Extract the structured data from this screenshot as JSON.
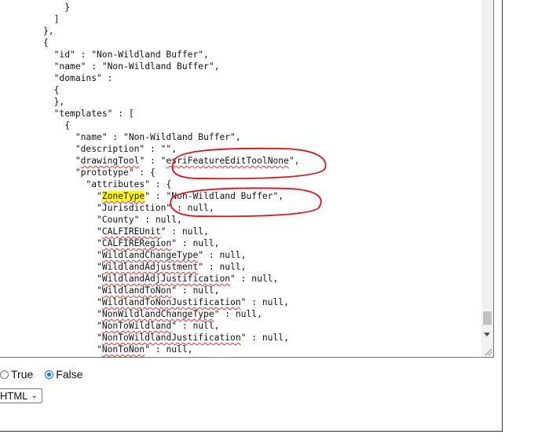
{
  "json_editor": {
    "lines": [
      {
        "indent": "      ",
        "segments": [
          {
            "text": "}"
          }
        ]
      },
      {
        "indent": "    ",
        "segments": [
          {
            "text": "}"
          }
        ]
      },
      {
        "indent": "  ",
        "segments": [
          {
            "text": "]"
          }
        ]
      },
      {
        "indent": "",
        "segments": [
          {
            "text": "},"
          }
        ]
      },
      {
        "indent": "",
        "segments": [
          {
            "text": "{"
          }
        ]
      },
      {
        "indent": "  ",
        "segments": [
          {
            "text": "\"id\" : \"Non-Wildland Buffer\","
          }
        ]
      },
      {
        "indent": "  ",
        "segments": [
          {
            "text": "\"name\" : \"Non-Wildland Buffer\","
          }
        ]
      },
      {
        "indent": "  ",
        "segments": [
          {
            "text": "\"domains\" :"
          }
        ]
      },
      {
        "indent": "  ",
        "segments": [
          {
            "text": "{"
          }
        ]
      },
      {
        "indent": "  ",
        "segments": [
          {
            "text": "},"
          }
        ]
      },
      {
        "indent": "  ",
        "segments": [
          {
            "text": "\"templates\" : ["
          }
        ]
      },
      {
        "indent": "    ",
        "segments": [
          {
            "text": "{"
          }
        ]
      },
      {
        "indent": "      ",
        "segments": [
          {
            "text": "\"name\" : \"Non-Wildland Buffer\","
          }
        ]
      },
      {
        "indent": "      ",
        "segments": [
          {
            "text": "\"description\" : \"\","
          }
        ]
      },
      {
        "indent": "      ",
        "segments": [
          {
            "text": "\""
          },
          {
            "text": "drawingTool",
            "squiggle": true
          },
          {
            "text": "\" : \""
          },
          {
            "text": "esriFeatureEditToolNone",
            "squiggle": true
          },
          {
            "text": "\","
          }
        ]
      },
      {
        "indent": "      ",
        "segments": [
          {
            "text": "\"prototype\" : {"
          }
        ]
      },
      {
        "indent": "        ",
        "segments": [
          {
            "text": "\"attributes\" : {"
          }
        ]
      },
      {
        "indent": "          ",
        "segments": [
          {
            "text": "\""
          },
          {
            "text": "ZoneType",
            "squiggle": true,
            "highlight": true
          },
          {
            "text": "\" : \"Non-Wildland Buffer\","
          }
        ]
      },
      {
        "indent": "          ",
        "segments": [
          {
            "text": "\"Jurisdiction\" : null,"
          }
        ]
      },
      {
        "indent": "          ",
        "segments": [
          {
            "text": "\"County\" : null,"
          }
        ]
      },
      {
        "indent": "          ",
        "segments": [
          {
            "text": "\""
          },
          {
            "text": "CALFIREUnit",
            "squiggle": true
          },
          {
            "text": "\" : null,"
          }
        ]
      },
      {
        "indent": "          ",
        "segments": [
          {
            "text": "\""
          },
          {
            "text": "CALFIRERegion",
            "squiggle": true
          },
          {
            "text": "\" : null,"
          }
        ]
      },
      {
        "indent": "          ",
        "segments": [
          {
            "text": "\""
          },
          {
            "text": "WildlandChangeType",
            "squiggle": true
          },
          {
            "text": "\" : null,"
          }
        ]
      },
      {
        "indent": "          ",
        "segments": [
          {
            "text": "\""
          },
          {
            "text": "WildlandAdjustment",
            "squiggle": true
          },
          {
            "text": "\" : null,"
          }
        ]
      },
      {
        "indent": "          ",
        "segments": [
          {
            "text": "\""
          },
          {
            "text": "WildlandAdjJustification",
            "squiggle": true
          },
          {
            "text": "\" : null,"
          }
        ]
      },
      {
        "indent": "          ",
        "segments": [
          {
            "text": "\""
          },
          {
            "text": "WildlandToNon",
            "squiggle": true
          },
          {
            "text": "\" : null,"
          }
        ]
      },
      {
        "indent": "          ",
        "segments": [
          {
            "text": "\""
          },
          {
            "text": "WildlandToNonJustification",
            "squiggle": true
          },
          {
            "text": "\" : null,"
          }
        ]
      },
      {
        "indent": "          ",
        "segments": [
          {
            "text": "\""
          },
          {
            "text": "NonWildlandChangeType",
            "squiggle": true
          },
          {
            "text": "\" : null,"
          }
        ]
      },
      {
        "indent": "          ",
        "segments": [
          {
            "text": "\""
          },
          {
            "text": "NonToWildland",
            "squiggle": true
          },
          {
            "text": "\" : null,"
          }
        ]
      },
      {
        "indent": "          ",
        "segments": [
          {
            "text": "\""
          },
          {
            "text": "NonToWildlandJustification",
            "squiggle": true
          },
          {
            "text": "\" : null,"
          }
        ]
      },
      {
        "indent": "          ",
        "segments": [
          {
            "text": "\""
          },
          {
            "text": "NonToNon",
            "squiggle": true
          },
          {
            "text": "\" : null,"
          }
        ]
      }
    ]
  },
  "options": {
    "radio_true_label": "True",
    "radio_false_label": "False",
    "selected": "False",
    "format_select_value": "HTML"
  },
  "colors": {
    "annotation": "#e0101a",
    "highlight": "#ffff00",
    "radio_accent": "#0075ff"
  },
  "icons": [
    "chevron-down-icon",
    "resize-grip-icon",
    "scroll-down-arrow-icon"
  ]
}
